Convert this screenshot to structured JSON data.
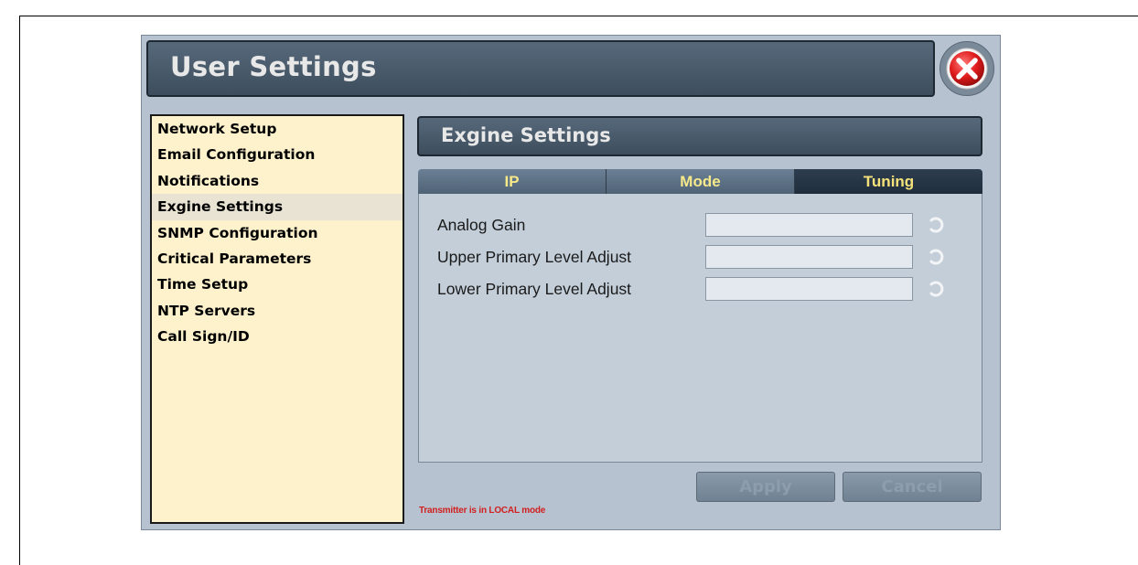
{
  "window": {
    "title": "User Settings"
  },
  "sidebar": {
    "items": [
      {
        "label": "Network Setup"
      },
      {
        "label": "Email Configuration"
      },
      {
        "label": "Notifications"
      },
      {
        "label": "Exgine Settings",
        "selected": true
      },
      {
        "label": "SNMP Configuration"
      },
      {
        "label": "Critical Parameters"
      },
      {
        "label": "Time Setup"
      },
      {
        "label": "NTP Servers"
      },
      {
        "label": "Call Sign/ID"
      }
    ]
  },
  "section": {
    "title": "Exgine Settings"
  },
  "tabs": [
    {
      "label": "IP"
    },
    {
      "label": "Mode"
    },
    {
      "label": "Tuning",
      "active": true
    }
  ],
  "params": [
    {
      "label": "Analog Gain",
      "value": ""
    },
    {
      "label": "Upper Primary Level Adjust",
      "value": ""
    },
    {
      "label": "Lower Primary Level Adjust",
      "value": ""
    }
  ],
  "buttons": {
    "apply": "Apply",
    "cancel": "Cancel"
  },
  "status": {
    "text": "Transmitter is in LOCAL mode"
  },
  "colors": {
    "panel_background": "#b6c2cf",
    "header_bar": "#3d4d5c",
    "sidebar_background": "#fef2cc",
    "tab_text": "#f5e98a",
    "status_text": "#d1201f",
    "close_button": "#e01c1c"
  },
  "icons": {
    "close": "close-icon",
    "refresh": "refresh-icon"
  }
}
